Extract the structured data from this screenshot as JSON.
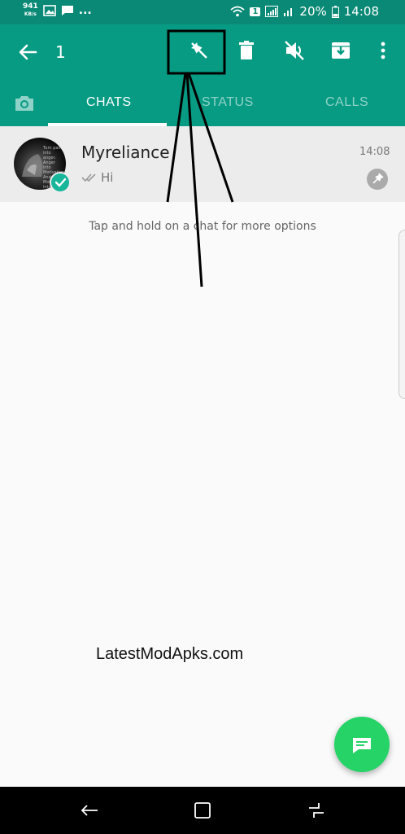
{
  "status_bar": {
    "speed_value": "941",
    "speed_unit": "KB/s",
    "more_indicator": "...",
    "sim_label": "1",
    "battery_percent": "20%",
    "time": "14:08"
  },
  "app_bar": {
    "selected_count": "1",
    "actions": [
      "unpin-icon",
      "delete-icon",
      "mute-icon",
      "archive-icon",
      "more-vert-icon"
    ]
  },
  "tabs": [
    {
      "label": "CHATS",
      "active": true
    },
    {
      "label": "STATUS",
      "active": false
    },
    {
      "label": "CALLS",
      "active": false
    }
  ],
  "chat": {
    "name": "Myreliance",
    "time": "14:08",
    "message": "Hi",
    "avatar_text": "Turn pain into anger. Anger into Motivation. And, Motivation into Success"
  },
  "hint": "Tap and hold on a chat for more options",
  "watermark": "LatestModApks.com",
  "colors": {
    "primary": "#079b83",
    "status_bar": "#0a8a76",
    "fab": "#25d366",
    "selection": "#ececec"
  }
}
